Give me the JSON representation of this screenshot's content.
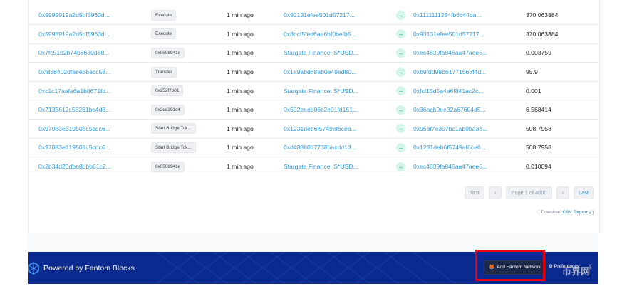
{
  "transactions": [
    {
      "hash": "0x5995919a2d5df5963d...",
      "method": "Execute",
      "age": "1 min ago",
      "from": "0x93131efee501d57217...",
      "from_link": true,
      "to": "0x1111111254fb6c44ba...",
      "value": "370.063884"
    },
    {
      "hash": "0x5995919a2d5df5963d...",
      "method": "Execute",
      "age": "1 min ago",
      "from": "0x8dcf5fed6ae6bf0befb5...",
      "from_link": true,
      "to": "0x93131efee501d57217...",
      "value": "370.063884"
    },
    {
      "hash": "0x7fc51b2b74b6630d80...",
      "method": "0x0508941e",
      "age": "1 min ago",
      "from": "Stargate Finance: S*USD...",
      "from_link": true,
      "to": "0xec4839fa846aa47aee6...",
      "value": "0.003759"
    },
    {
      "hash": "0xfd38402dfaee56acc58...",
      "method": "Transfer",
      "age": "1 min ago",
      "from": "0x1a9abd68ab0e49ed80...",
      "from_link": true,
      "to": "0xb9fdd98b61771568f4d...",
      "value": "95.9"
    },
    {
      "hash": "0xc1c17aafa6a1b8671fd...",
      "method": "0x252f7b01",
      "age": "1 min ago",
      "from": "Stargate Finance: S*USD...",
      "from_link": true,
      "to": "0xfcf15d5a4a6f841ac2c...",
      "value": "0.001"
    },
    {
      "hash": "0x7135612c58261bc4d8...",
      "method": "0x2ed391c4",
      "age": "1 min ago",
      "from": "0x502eeeb06c2e01fd151...",
      "from_link": true,
      "to": "0x36acb9ee32a67604d5...",
      "value": "6.568414"
    },
    {
      "hash": "0x97083e319508c5cdc6...",
      "method": "Start Bridge Tok...",
      "age": "1 min ago",
      "from": "0x1231deb6f5749ef6ce6...",
      "from_link": true,
      "to": "0x95bf7e307bc1ab0ba38...",
      "value": "508.7958"
    },
    {
      "hash": "0x97083e319508c5cdc6...",
      "method": "Start Bridge Tok...",
      "age": "1 min ago",
      "from": "0xd48880b7738bacdd13...",
      "from_link": true,
      "to": "0x1231deb6f5749ef6ce6...",
      "value": "508.7958"
    },
    {
      "hash": "0x2b34d20dba8bbb61c2...",
      "method": "0x0508941e",
      "age": "1 min ago",
      "from": "Stargate Finance: S*USD...",
      "from_link": true,
      "to": "0xec4839fa846aa47aee6...",
      "value": "0.010094"
    }
  ],
  "arrow_icon": "arrow-right-icon",
  "pagination": {
    "first": "First",
    "prev": "‹",
    "page": "Page 1 of 4000",
    "next": "›",
    "last": "Last"
  },
  "csv": {
    "prefix": "[ Download ",
    "link": "CSV Export",
    "suffix": " ]"
  },
  "footer": {
    "brand": "Powered by Fantom Blocks",
    "add_network": "Add Fantom Network",
    "preferences": "Preferences",
    "theme_icon": "moon-icon"
  },
  "watermark": "币界网",
  "colors": {
    "link": "#3498db",
    "footer_bg": "#0b2a8f",
    "highlight": "#e60012",
    "arrow_green": "#00a186"
  }
}
